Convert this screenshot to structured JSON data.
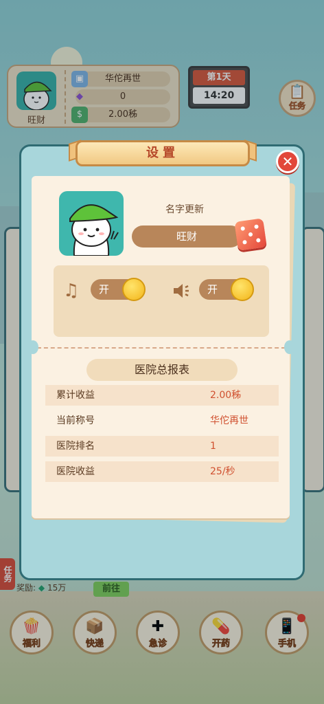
{
  "hud": {
    "player_name": "旺财",
    "title": "华佗再世",
    "diamonds": "0",
    "money": "2.00秭",
    "day": "第1天",
    "time": "14:20",
    "task_label": "任务"
  },
  "side_task": {
    "label": "任务",
    "reward_label": "奖励:",
    "reward_value": "15万",
    "go_button": "前往"
  },
  "bottom_nav": [
    {
      "label": "福利",
      "icon": "popcorn-icon"
    },
    {
      "label": "快递",
      "icon": "parcel-icon"
    },
    {
      "label": "急诊",
      "icon": "first-aid-kit-icon"
    },
    {
      "label": "开药",
      "icon": "medicine-icon"
    },
    {
      "label": "手机",
      "icon": "phone-icon"
    }
  ],
  "settings": {
    "title": "设置",
    "name_update_label": "名字更新",
    "name_value": "旺财",
    "music_toggle": "开",
    "sound_toggle": "开",
    "music_on": true,
    "sound_on": true,
    "report_title": "医院总报表",
    "stats": [
      {
        "label": "累计收益",
        "value": "2.00秭"
      },
      {
        "label": "当前称号",
        "value": "华佗再世"
      },
      {
        "label": "医院排名",
        "value": "1"
      },
      {
        "label": "医院收益",
        "value": "25/秒"
      }
    ]
  },
  "colors": {
    "accent_red": "#e2473a",
    "value_red": "#d0502f",
    "brown": "#b8865a",
    "teal": "#a8d6db"
  }
}
